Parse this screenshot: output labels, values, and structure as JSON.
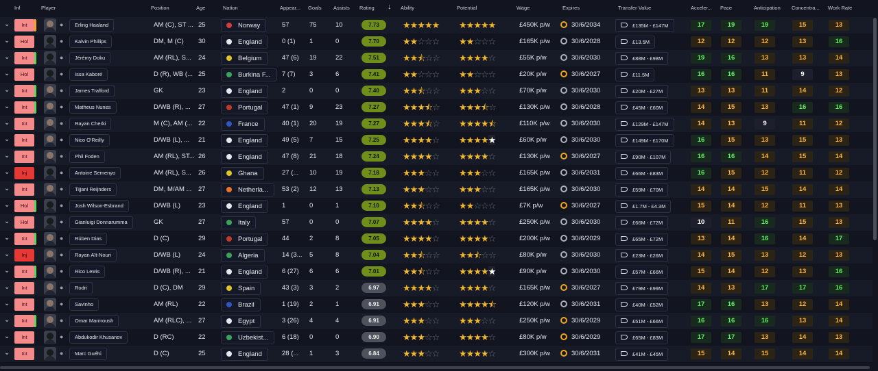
{
  "headers": [
    "Inf",
    "Player",
    "Position",
    "Age",
    "Nation",
    "Appear...",
    "Goals",
    "Assists",
    "Rating",
    "Ability",
    "Potential",
    "Wage",
    "Expires",
    "Transfer Value",
    "Acceler...",
    "Pace",
    "Anticipation",
    "Concentra...",
    "Work Rate"
  ],
  "players": [
    {
      "inf": "Int",
      "inf_bar": "#f2a51d",
      "name": "Erling Haaland",
      "avatar": "light",
      "position": "AM (C), ST ...",
      "age": "25",
      "nation": "Norway",
      "flag": "#d23c3c",
      "apps": "57",
      "goals": "75",
      "assists": "10",
      "rating": "7.73",
      "rating_level": "hi",
      "ability": [
        "on",
        "on",
        "on",
        "on",
        "on"
      ],
      "potential": [
        "on",
        "on",
        "on",
        "on",
        "on"
      ],
      "wage": "£450K p/w",
      "expires": "30/6/2034",
      "exp_warn": true,
      "tv": "£135M - £147M",
      "attrs": [
        [
          "17",
          "g"
        ],
        [
          "19",
          "g"
        ],
        [
          "19",
          "g"
        ],
        [
          "15",
          "o"
        ],
        [
          "13",
          "o"
        ]
      ]
    },
    {
      "inf": "Hol",
      "inf_bar": "",
      "name": "Kalvin Phillips",
      "avatar": "dark",
      "position": "DM, M (C)",
      "age": "30",
      "nation": "England",
      "flag": "#e7e7ef",
      "apps": "0 (1)",
      "goals": "1",
      "assists": "0",
      "rating": "7.70",
      "rating_level": "hi",
      "ability": [
        "on",
        "on",
        "off",
        "off",
        "off"
      ],
      "potential": [
        "on",
        "on",
        "off",
        "off",
        "off"
      ],
      "wage": "£165K p/w",
      "expires": "30/6/2028",
      "exp_warn": false,
      "tv": "£13.5M",
      "attrs": [
        [
          "12",
          "o"
        ],
        [
          "12",
          "o"
        ],
        [
          "12",
          "o"
        ],
        [
          "13",
          "o"
        ],
        [
          "16",
          "g"
        ]
      ]
    },
    {
      "inf": "Int",
      "inf_bar": "#5fd35f",
      "name": "Jérémy Doku",
      "avatar": "dark",
      "position": "AM (RL), S...",
      "age": "24",
      "nation": "Belgium",
      "flag": "#e6c229",
      "apps": "47 (6)",
      "goals": "19",
      "assists": "22",
      "rating": "7.51",
      "rating_level": "hi",
      "ability": [
        "on",
        "on",
        "half",
        "off",
        "off"
      ],
      "potential": [
        "on",
        "on",
        "on",
        "on",
        "off"
      ],
      "wage": "£55K p/w",
      "expires": "30/6/2030",
      "exp_warn": false,
      "tv": "£88M - £98M",
      "attrs": [
        [
          "19",
          "g"
        ],
        [
          "16",
          "g"
        ],
        [
          "13",
          "o"
        ],
        [
          "13",
          "o"
        ],
        [
          "14",
          "o"
        ]
      ]
    },
    {
      "inf": "Hol",
      "inf_bar": "",
      "name": "Issa Kaboré",
      "avatar": "dark",
      "position": "D (R), WB (...",
      "age": "25",
      "nation": "Burkina F...",
      "flag": "#3aa35a",
      "apps": "7 (7)",
      "goals": "3",
      "assists": "6",
      "rating": "7.41",
      "rating_level": "hi",
      "ability": [
        "on",
        "on",
        "off",
        "off",
        "off"
      ],
      "potential": [
        "on",
        "on",
        "off",
        "off",
        "off"
      ],
      "wage": "£20K p/w",
      "expires": "30/6/2027",
      "exp_warn": true,
      "tv": "£11.5M",
      "attrs": [
        [
          "16",
          "g"
        ],
        [
          "16",
          "g"
        ],
        [
          "11",
          "o"
        ],
        [
          "9",
          "w"
        ],
        [
          "13",
          "o"
        ]
      ]
    },
    {
      "inf": "Int",
      "inf_bar": "#5fd35f",
      "name": "James Trafford",
      "avatar": "light",
      "position": "GK",
      "age": "23",
      "nation": "England",
      "flag": "#e7e7ef",
      "apps": "2",
      "goals": "0",
      "assists": "0",
      "rating": "7.40",
      "rating_level": "hi",
      "ability": [
        "on",
        "on",
        "half",
        "off",
        "off"
      ],
      "potential": [
        "on",
        "on",
        "on",
        "off",
        "off"
      ],
      "wage": "£70K p/w",
      "expires": "30/6/2030",
      "exp_warn": false,
      "tv": "£20M - £27M",
      "attrs": [
        [
          "13",
          "o"
        ],
        [
          "13",
          "o"
        ],
        [
          "11",
          "o"
        ],
        [
          "14",
          "o"
        ],
        [
          "12",
          "o"
        ]
      ]
    },
    {
      "inf": "Int",
      "inf_bar": "#5fd35f",
      "name": "Matheus Nunes",
      "avatar": "light",
      "position": "D/WB (R), ...",
      "age": "27",
      "nation": "Portugal",
      "flag": "#c0392b",
      "apps": "47 (1)",
      "goals": "9",
      "assists": "23",
      "rating": "7.27",
      "rating_level": "hi",
      "ability": [
        "on",
        "on",
        "on",
        "half",
        "off"
      ],
      "potential": [
        "on",
        "on",
        "on",
        "half",
        "off"
      ],
      "wage": "£130K p/w",
      "expires": "30/6/2028",
      "exp_warn": false,
      "tv": "£45M - £60M",
      "attrs": [
        [
          "14",
          "o"
        ],
        [
          "15",
          "o"
        ],
        [
          "13",
          "o"
        ],
        [
          "16",
          "g"
        ],
        [
          "16",
          "g"
        ]
      ]
    },
    {
      "inf": "Int",
      "inf_bar": "",
      "name": "Rayan Cherki",
      "avatar": "light",
      "position": "M (C), AM (...",
      "age": "22",
      "nation": "France",
      "flag": "#3056c2",
      "apps": "40 (1)",
      "goals": "20",
      "assists": "19",
      "rating": "7.27",
      "rating_level": "hi",
      "ability": [
        "on",
        "on",
        "on",
        "half",
        "off"
      ],
      "potential": [
        "on",
        "on",
        "on",
        "on",
        "half"
      ],
      "wage": "£110K p/w",
      "expires": "30/6/2030",
      "exp_warn": false,
      "tv": "£129M - £147M",
      "attrs": [
        [
          "14",
          "o"
        ],
        [
          "13",
          "o"
        ],
        [
          "9",
          "w"
        ],
        [
          "11",
          "o"
        ],
        [
          "12",
          "o"
        ]
      ]
    },
    {
      "inf": "Int",
      "inf_bar": "",
      "name": "Nico O'Reilly",
      "avatar": "light",
      "position": "D/WB (L), ...",
      "age": "21",
      "nation": "England",
      "flag": "#e7e7ef",
      "apps": "49 (5)",
      "goals": "7",
      "assists": "15",
      "rating": "7.25",
      "rating_level": "hi",
      "ability": [
        "on",
        "on",
        "on",
        "on",
        "off"
      ],
      "potential": [
        "on",
        "on",
        "on",
        "on",
        "w"
      ],
      "wage": "£60K p/w",
      "expires": "30/6/2030",
      "exp_warn": false,
      "tv": "£149M - £170M",
      "attrs": [
        [
          "16",
          "g"
        ],
        [
          "15",
          "o"
        ],
        [
          "13",
          "o"
        ],
        [
          "15",
          "o"
        ],
        [
          "13",
          "o"
        ]
      ]
    },
    {
      "inf": "Int",
      "inf_bar": "",
      "name": "Phil Foden",
      "avatar": "light",
      "position": "AM (RL), ST...",
      "age": "26",
      "nation": "England",
      "flag": "#e7e7ef",
      "apps": "47 (8)",
      "goals": "21",
      "assists": "18",
      "rating": "7.24",
      "rating_level": "hi",
      "ability": [
        "on",
        "on",
        "on",
        "on",
        "off"
      ],
      "potential": [
        "on",
        "on",
        "on",
        "on",
        "off"
      ],
      "wage": "£130K p/w",
      "expires": "30/6/2027",
      "exp_warn": true,
      "tv": "£90M - £107M",
      "attrs": [
        [
          "16",
          "g"
        ],
        [
          "16",
          "g"
        ],
        [
          "14",
          "o"
        ],
        [
          "15",
          "o"
        ],
        [
          "14",
          "o"
        ]
      ]
    },
    {
      "inf": "Inj",
      "inf_bar": "",
      "name": "Antoine Semenyo",
      "avatar": "dark",
      "position": "AM (RL), S...",
      "age": "26",
      "nation": "Ghana",
      "flag": "#e6c229",
      "apps": "27 (...",
      "goals": "10",
      "assists": "19",
      "rating": "7.18",
      "rating_level": "hi",
      "ability": [
        "on",
        "on",
        "on",
        "off",
        "off"
      ],
      "potential": [
        "on",
        "on",
        "on",
        "off",
        "off"
      ],
      "wage": "£165K p/w",
      "expires": "30/6/2031",
      "exp_warn": false,
      "tv": "£66M - £83M",
      "attrs": [
        [
          "16",
          "g"
        ],
        [
          "15",
          "o"
        ],
        [
          "12",
          "o"
        ],
        [
          "11",
          "o"
        ],
        [
          "12",
          "o"
        ]
      ]
    },
    {
      "inf": "Int",
      "inf_bar": "",
      "name": "Tijjani Reijnders",
      "avatar": "light",
      "position": "DM, M/AM ...",
      "age": "27",
      "nation": "Netherla...",
      "flag": "#e8742a",
      "apps": "53 (2)",
      "goals": "12",
      "assists": "13",
      "rating": "7.13",
      "rating_level": "hi",
      "ability": [
        "on",
        "on",
        "on",
        "off",
        "off"
      ],
      "potential": [
        "on",
        "on",
        "on",
        "off",
        "off"
      ],
      "wage": "£165K p/w",
      "expires": "30/6/2030",
      "exp_warn": false,
      "tv": "£59M - £70M",
      "attrs": [
        [
          "14",
          "o"
        ],
        [
          "14",
          "o"
        ],
        [
          "15",
          "o"
        ],
        [
          "14",
          "o"
        ],
        [
          "14",
          "o"
        ]
      ]
    },
    {
      "inf": "Hol",
      "inf_bar": "#5fd35f",
      "name": "Josh Wilson-Esbrand",
      "avatar": "dark",
      "position": "D/WB (L)",
      "age": "23",
      "nation": "England",
      "flag": "#e7e7ef",
      "apps": "1",
      "goals": "0",
      "assists": "1",
      "rating": "7.10",
      "rating_level": "hi",
      "ability": [
        "on",
        "on",
        "half",
        "off",
        "off"
      ],
      "potential": [
        "on",
        "on",
        "off",
        "off",
        "off"
      ],
      "wage": "£7K p/w",
      "expires": "30/6/2027",
      "exp_warn": true,
      "tv": "£1.7M - £4.3M",
      "attrs": [
        [
          "15",
          "o"
        ],
        [
          "14",
          "o"
        ],
        [
          "12",
          "o"
        ],
        [
          "11",
          "o"
        ],
        [
          "13",
          "o"
        ]
      ]
    },
    {
      "inf": "Hol",
      "inf_bar": "",
      "name": "Gianluigi Donnarumma",
      "avatar": "dark",
      "position": "GK",
      "age": "27",
      "nation": "Italy",
      "flag": "#3aa35a",
      "apps": "57",
      "goals": "0",
      "assists": "0",
      "rating": "7.07",
      "rating_level": "hi",
      "ability": [
        "on",
        "on",
        "on",
        "on",
        "off"
      ],
      "potential": [
        "on",
        "on",
        "on",
        "on",
        "off"
      ],
      "wage": "£250K p/w",
      "expires": "30/6/2030",
      "exp_warn": false,
      "tv": "£66M - £72M",
      "attrs": [
        [
          "10",
          "w"
        ],
        [
          "11",
          "o"
        ],
        [
          "16",
          "g"
        ],
        [
          "15",
          "o"
        ],
        [
          "13",
          "o"
        ]
      ]
    },
    {
      "inf": "Int",
      "inf_bar": "#5fd35f",
      "name": "Rúben Dias",
      "avatar": "light",
      "position": "D (C)",
      "age": "29",
      "nation": "Portugal",
      "flag": "#c0392b",
      "apps": "44",
      "goals": "2",
      "assists": "8",
      "rating": "7.05",
      "rating_level": "hi",
      "ability": [
        "on",
        "on",
        "on",
        "on",
        "off"
      ],
      "potential": [
        "on",
        "on",
        "on",
        "on",
        "off"
      ],
      "wage": "£200K p/w",
      "expires": "30/6/2029",
      "exp_warn": false,
      "tv": "£65M - £72M",
      "attrs": [
        [
          "13",
          "o"
        ],
        [
          "14",
          "o"
        ],
        [
          "16",
          "g"
        ],
        [
          "14",
          "o"
        ],
        [
          "17",
          "g"
        ]
      ]
    },
    {
      "inf": "Inj",
      "inf_bar": "",
      "name": "Rayan Aït-Nouri",
      "avatar": "light",
      "position": "D/WB (L)",
      "age": "24",
      "nation": "Algeria",
      "flag": "#3aa35a",
      "apps": "14 (3...",
      "goals": "5",
      "assists": "8",
      "rating": "7.04",
      "rating_level": "hi",
      "ability": [
        "on",
        "on",
        "half",
        "off",
        "off"
      ],
      "potential": [
        "on",
        "on",
        "half",
        "off",
        "off"
      ],
      "wage": "£80K p/w",
      "expires": "30/6/2030",
      "exp_warn": false,
      "tv": "£23M - £26M",
      "attrs": [
        [
          "14",
          "o"
        ],
        [
          "15",
          "o"
        ],
        [
          "13",
          "o"
        ],
        [
          "12",
          "o"
        ],
        [
          "13",
          "o"
        ]
      ]
    },
    {
      "inf": "Int",
      "inf_bar": "#5fd35f",
      "name": "Rico Lewis",
      "avatar": "light",
      "position": "D/WB (R), ...",
      "age": "21",
      "nation": "England",
      "flag": "#e7e7ef",
      "apps": "6 (27)",
      "goals": "6",
      "assists": "6",
      "rating": "7.01",
      "rating_level": "hi",
      "ability": [
        "on",
        "on",
        "half",
        "off",
        "off"
      ],
      "potential": [
        "on",
        "on",
        "on",
        "on",
        "w"
      ],
      "wage": "£90K p/w",
      "expires": "30/6/2030",
      "exp_warn": false,
      "tv": "£57M - £66M",
      "attrs": [
        [
          "15",
          "o"
        ],
        [
          "14",
          "o"
        ],
        [
          "12",
          "o"
        ],
        [
          "13",
          "o"
        ],
        [
          "16",
          "g"
        ]
      ]
    },
    {
      "inf": "Int",
      "inf_bar": "",
      "name": "Rodri",
      "avatar": "light",
      "position": "D (C), DM",
      "age": "29",
      "nation": "Spain",
      "flag": "#e6c229",
      "apps": "43 (3)",
      "goals": "3",
      "assists": "2",
      "rating": "6.97",
      "rating_level": "mid",
      "ability": [
        "on",
        "on",
        "on",
        "on",
        "off"
      ],
      "potential": [
        "on",
        "on",
        "on",
        "on",
        "off"
      ],
      "wage": "£165K p/w",
      "expires": "30/6/2027",
      "exp_warn": true,
      "tv": "£79M - £99M",
      "attrs": [
        [
          "14",
          "o"
        ],
        [
          "13",
          "o"
        ],
        [
          "17",
          "g"
        ],
        [
          "17",
          "g"
        ],
        [
          "16",
          "g"
        ]
      ]
    },
    {
      "inf": "Int",
      "inf_bar": "",
      "name": "Savinho",
      "avatar": "light",
      "position": "AM (RL)",
      "age": "22",
      "nation": "Brazil",
      "flag": "#3056c2",
      "apps": "1 (19)",
      "goals": "2",
      "assists": "1",
      "rating": "6.91",
      "rating_level": "mid",
      "ability": [
        "on",
        "on",
        "on",
        "off",
        "off"
      ],
      "potential": [
        "on",
        "on",
        "on",
        "on",
        "half"
      ],
      "wage": "£120K p/w",
      "expires": "30/6/2031",
      "exp_warn": false,
      "tv": "£40M - £52M",
      "attrs": [
        [
          "17",
          "g"
        ],
        [
          "16",
          "g"
        ],
        [
          "13",
          "o"
        ],
        [
          "12",
          "o"
        ],
        [
          "14",
          "o"
        ]
      ]
    },
    {
      "inf": "Int",
      "inf_bar": "#5fd35f",
      "name": "Omar Marmoush",
      "avatar": "light",
      "position": "AM (RLC), ...",
      "age": "27",
      "nation": "Egypt",
      "flag": "#e7e7ef",
      "apps": "3 (26)",
      "goals": "4",
      "assists": "4",
      "rating": "6.91",
      "rating_level": "mid",
      "ability": [
        "on",
        "on",
        "on",
        "off",
        "off"
      ],
      "potential": [
        "on",
        "on",
        "on",
        "off",
        "off"
      ],
      "wage": "£250K p/w",
      "expires": "30/6/2029",
      "exp_warn": true,
      "tv": "£51M - £66M",
      "attrs": [
        [
          "16",
          "g"
        ],
        [
          "16",
          "g"
        ],
        [
          "16",
          "g"
        ],
        [
          "13",
          "o"
        ],
        [
          "14",
          "o"
        ]
      ]
    },
    {
      "inf": "Int",
      "inf_bar": "",
      "name": "Abdukodir Khusanov",
      "avatar": "dark",
      "position": "D (RC)",
      "age": "22",
      "nation": "Uzbekist...",
      "flag": "#3aa35a",
      "apps": "6 (18)",
      "goals": "0",
      "assists": "0",
      "rating": "6.90",
      "rating_level": "mid",
      "ability": [
        "on",
        "on",
        "on",
        "off",
        "off"
      ],
      "potential": [
        "on",
        "on",
        "on",
        "on",
        "off"
      ],
      "wage": "£80K p/w",
      "expires": "30/6/2029",
      "exp_warn": true,
      "tv": "£65M - £83M",
      "attrs": [
        [
          "17",
          "g"
        ],
        [
          "17",
          "g"
        ],
        [
          "13",
          "o"
        ],
        [
          "14",
          "o"
        ],
        [
          "13",
          "o"
        ]
      ]
    },
    {
      "inf": "Int",
      "inf_bar": "",
      "name": "Marc Guéhi",
      "avatar": "dark",
      "position": "D (C)",
      "age": "25",
      "nation": "England",
      "flag": "#e7e7ef",
      "apps": "28 (...",
      "goals": "1",
      "assists": "3",
      "rating": "6.84",
      "rating_level": "mid",
      "ability": [
        "on",
        "on",
        "on",
        "off",
        "off"
      ],
      "potential": [
        "on",
        "on",
        "on",
        "on",
        "off"
      ],
      "wage": "£300K p/w",
      "expires": "30/6/2031",
      "exp_warn": true,
      "tv": "£41M - £45M",
      "attrs": [
        [
          "15",
          "o"
        ],
        [
          "14",
          "o"
        ],
        [
          "15",
          "o"
        ],
        [
          "14",
          "o"
        ],
        [
          "14",
          "o"
        ]
      ]
    }
  ]
}
